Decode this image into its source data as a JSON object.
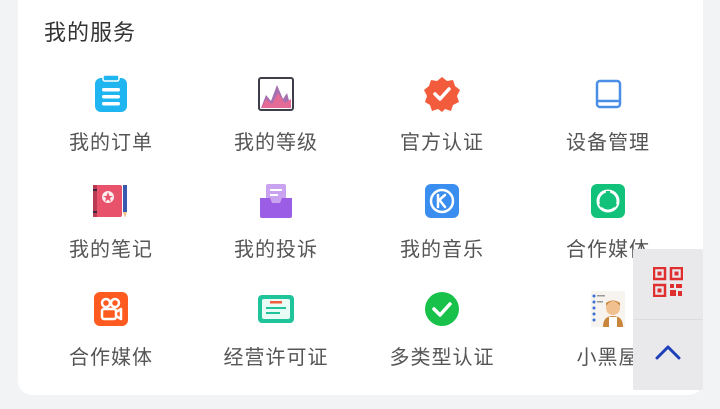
{
  "section": {
    "title": "我的服务"
  },
  "services": [
    {
      "label": "我的订单",
      "icon": "clipboard-icon",
      "color": "#1fb5f0"
    },
    {
      "label": "我的等级",
      "icon": "chart-image-icon",
      "color": "#7b5b8c"
    },
    {
      "label": "官方认证",
      "icon": "verified-badge-icon",
      "color": "#f25c3c"
    },
    {
      "label": "设备管理",
      "icon": "tablet-icon",
      "color": "#4a8ee8"
    },
    {
      "label": "我的笔记",
      "icon": "notebook-icon",
      "color": "#e8526a"
    },
    {
      "label": "我的投诉",
      "icon": "inbox-complaint-icon",
      "color": "#9b5de5"
    },
    {
      "label": "我的音乐",
      "icon": "music-k-icon",
      "color": "#3a8ef0"
    },
    {
      "label": "合作媒体",
      "icon": "media-green-icon",
      "color": "#12c27a"
    },
    {
      "label": "合作媒体",
      "icon": "media-orange-icon",
      "color": "#ff5a1f"
    },
    {
      "label": "经营许可证",
      "icon": "license-card-icon",
      "color": "#1fc49a"
    },
    {
      "label": "多类型认证",
      "icon": "check-circle-icon",
      "color": "#18c24a"
    },
    {
      "label": "小黑屋",
      "icon": "blacklist-person-icon",
      "color": "#c9863b"
    }
  ],
  "floating": {
    "qr_icon": "qr-code-icon",
    "top_icon": "chevron-up-icon",
    "accent": "#e02f2f",
    "up_color": "#1d3fb8"
  }
}
